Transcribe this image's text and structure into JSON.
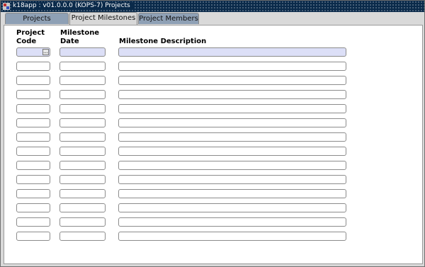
{
  "window": {
    "title": "k18app : v01.0.0.0 (KOPS-7) Projects"
  },
  "tabs": [
    {
      "label": "Projects",
      "active": false
    },
    {
      "label": "Project Milestones",
      "active": true
    },
    {
      "label": "Project Members",
      "active": false
    }
  ],
  "columns": {
    "project_code": "Project\nCode",
    "milestone_date": "Milestone\nDate",
    "milestone_description": "Milestone Description"
  },
  "rows": 14,
  "lov_glyph": "...",
  "colors": {
    "titlebar": "#0a2a4a",
    "inactive_tab": "#8ea0b5",
    "current_record": "#dcdff7"
  }
}
